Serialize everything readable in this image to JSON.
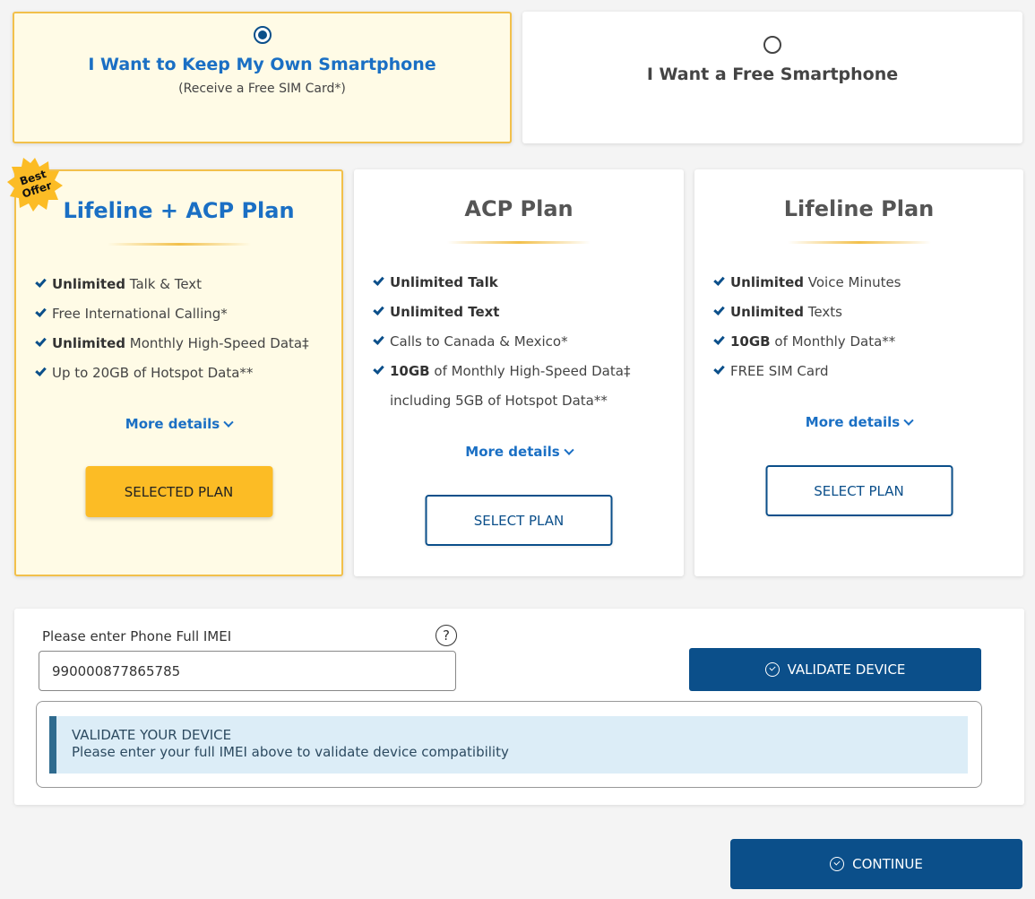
{
  "device_choice": {
    "own": {
      "title": "I Want to Keep My Own Smartphone",
      "subtitle": "(Receive a Free SIM Card*)",
      "selected": true
    },
    "free": {
      "title": "I Want a Free Smartphone",
      "selected": false
    }
  },
  "badge": {
    "line1": "Best",
    "line2": "Offer"
  },
  "plans": [
    {
      "title": "Lifeline + ACP Plan",
      "features": [
        {
          "bold": "Unlimited",
          "text": " Talk & Text"
        },
        {
          "bold": "",
          "text": "Free International Calling*"
        },
        {
          "bold": "Unlimited",
          "text": " Monthly High-Speed Data‡"
        },
        {
          "bold": "",
          "text": "Up to 20GB of Hotspot Data**"
        }
      ],
      "more_details": "More details",
      "button": "SELECTED PLAN"
    },
    {
      "title": "ACP Plan",
      "features": [
        {
          "bold": "Unlimited Talk",
          "text": ""
        },
        {
          "bold": "Unlimited Text",
          "text": ""
        },
        {
          "bold": "",
          "text": "Calls to Canada & Mexico*"
        },
        {
          "bold": "10GB",
          "text": " of Monthly High-Speed Data‡",
          "cont": "including 5GB of Hotspot Data**"
        }
      ],
      "more_details": "More details",
      "button": "SELECT PLAN"
    },
    {
      "title": "Lifeline Plan",
      "features": [
        {
          "bold": "Unlimited",
          "text": " Voice Minutes"
        },
        {
          "bold": "Unlimited",
          "text": " Texts"
        },
        {
          "bold": "10GB",
          "text": " of Monthly Data**"
        },
        {
          "bold": "",
          "text": "FREE SIM Card"
        }
      ],
      "more_details": "More details",
      "button": "SELECT PLAN"
    }
  ],
  "imei": {
    "label": "Please enter Phone Full IMEI",
    "help": "?",
    "value": "990000877865785",
    "validate_button": "VALIDATE DEVICE",
    "alert_title": "VALIDATE YOUR DEVICE",
    "alert_message": "Please enter your full IMEI above to validate device compatibility"
  },
  "continue_button": "CONTINUE",
  "colors": {
    "brand_blue": "#0b4f8a",
    "accent_yellow": "#fcbc25",
    "link_blue": "#1a6fc4"
  }
}
